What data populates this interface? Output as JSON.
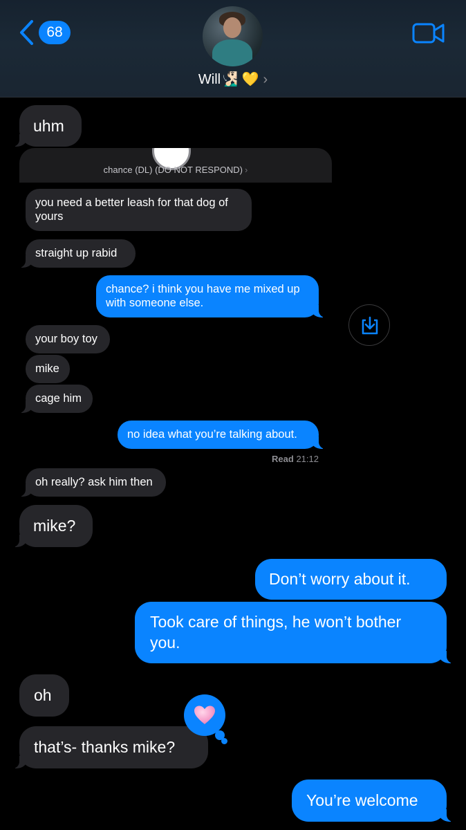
{
  "header": {
    "back_count": "68",
    "contact_name": "Will🧏🏻‍♂️ 💛",
    "icons": {
      "back": "chevron-left-icon",
      "video": "video-camera-icon",
      "disclosure": "chevron-right-icon"
    }
  },
  "reply_context": {
    "label": "chance (DL) (DO NOT RESPOND)"
  },
  "messages": [
    {
      "dir": "in",
      "text": "uhm"
    },
    {
      "dir": "in",
      "text": "you need a better leash for that dog of yours"
    },
    {
      "dir": "in",
      "text": "straight up rabid"
    },
    {
      "dir": "out",
      "text": "chance? i think you have me mixed up with someone else."
    },
    {
      "dir": "in",
      "text": "your boy toy"
    },
    {
      "dir": "in",
      "text": "mike"
    },
    {
      "dir": "in",
      "text": "cage him"
    },
    {
      "dir": "out",
      "text": "no idea what you’re talking about."
    },
    {
      "dir": "in",
      "text": "oh really? ask him then"
    },
    {
      "dir": "in",
      "text": "mike?"
    },
    {
      "dir": "out",
      "text": "Don’t worry about it."
    },
    {
      "dir": "out",
      "text": "Took care of things, he won’t bother you."
    },
    {
      "dir": "in",
      "text": "oh"
    },
    {
      "dir": "in",
      "text": "that’s- thanks mike?"
    },
    {
      "dir": "out",
      "text": "You’re welcome"
    }
  ],
  "read_receipt": {
    "label": "Read",
    "time": "21:12"
  },
  "tapback": {
    "icon": "pink-heart-icon",
    "color": "#0a84ff"
  },
  "colors": {
    "outgoing": "#0a84ff",
    "incoming": "#26262a",
    "background": "#000000"
  }
}
